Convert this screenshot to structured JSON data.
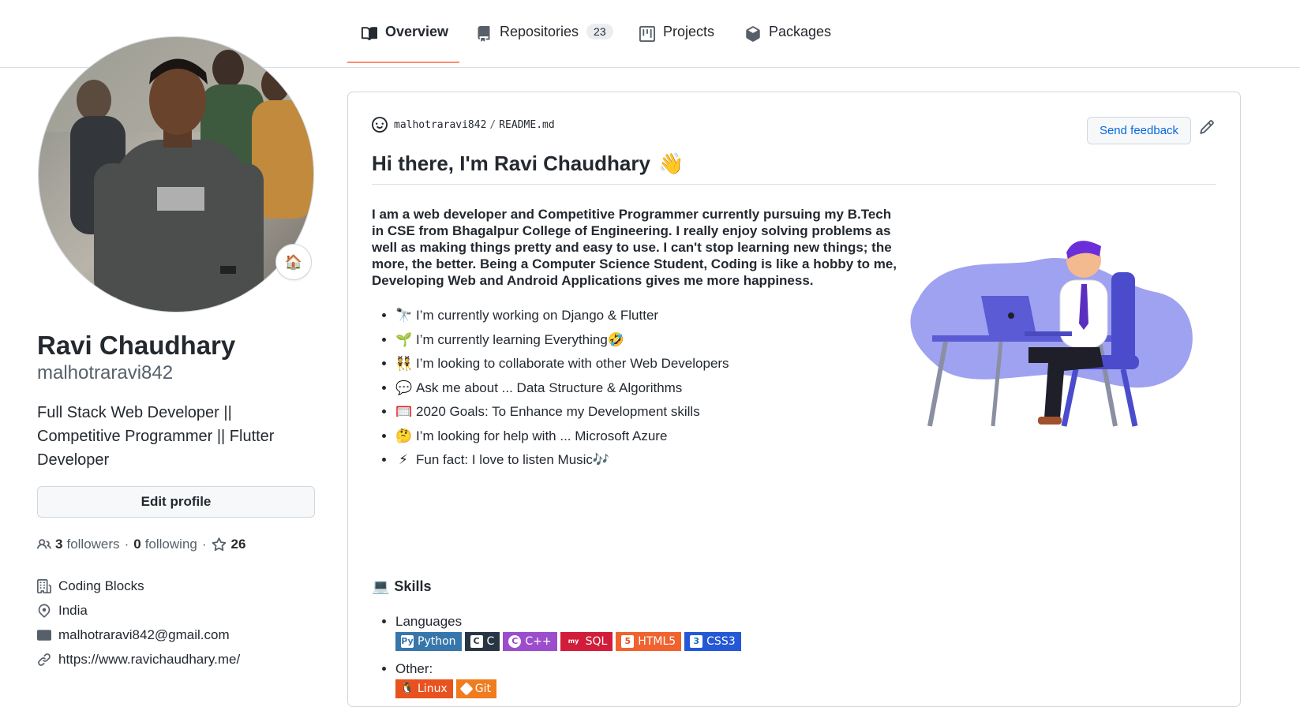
{
  "nav": {
    "tabs": [
      {
        "label": "Overview",
        "icon": "book-icon",
        "active": true
      },
      {
        "label": "Repositories",
        "icon": "repo-icon",
        "count": "23"
      },
      {
        "label": "Projects",
        "icon": "project-icon"
      },
      {
        "label": "Packages",
        "icon": "package-icon"
      }
    ]
  },
  "profile": {
    "name": "Ravi Chaudhary",
    "login": "malhotraravi842",
    "bio": "Full Stack Web Developer || Competitive Programmer || Flutter Developer",
    "status_emoji": "🏠",
    "edit_label": "Edit profile",
    "followers_count": "3",
    "followers_label": "followers",
    "following_count": "0",
    "following_label": "following",
    "stars_count": "26",
    "separator": "·",
    "company": "Coding Blocks",
    "location": "India",
    "email": "malhotraravi842@gmail.com",
    "website": "https://www.ravichaudhary.me/"
  },
  "readme": {
    "owner": "malhotraravi842",
    "separator": "/",
    "file": "README.md",
    "feedback_label": "Send feedback",
    "title": "Hi there, I'm Ravi Chaudhary",
    "title_emoji": "👋",
    "intro": "I am a web developer and Competitive Programmer currently pursuing my B.Tech in CSE from Bhagalpur College of Engineering. I really enjoy solving problems as well as making things pretty and easy to use. I can't stop learning new things; the more, the better. Being a Computer Science Student, Coding is like a hobby to me, Developing Web and Android Applications gives me more happiness.",
    "facts": [
      {
        "emoji": "🔭",
        "text": "I’m currently working on Django & Flutter"
      },
      {
        "emoji": "🌱",
        "text": "I’m currently learning Everything🤣"
      },
      {
        "emoji": "👯",
        "text": "I’m looking to collaborate with other Web Developers"
      },
      {
        "emoji": "💬",
        "text": "Ask me about ... Data Structure & Algorithms"
      },
      {
        "emoji": "🥅",
        "text": "2020 Goals: To Enhance my Development skills"
      },
      {
        "emoji": "🤔",
        "text": "I’m looking for help with ... Microsoft Azure"
      },
      {
        "emoji": "⚡",
        "text": "Fun fact: I love to listen Music🎶"
      }
    ],
    "skills_emoji": "💻",
    "skills_title": "Skills",
    "languages_label": "Languages",
    "languages": [
      {
        "label": "Python",
        "color": "#3776ab",
        "icon": "python-icon"
      },
      {
        "label": "C",
        "color": "#03599c",
        "icon": "c-icon"
      },
      {
        "label": "C++",
        "color": "#9c4dcc",
        "icon": "cpp-icon"
      },
      {
        "label": "SQL",
        "color": "#e02525",
        "icon": "mysql-icon"
      },
      {
        "label": "HTML5",
        "color": "#e34f26",
        "icon": "html5-icon"
      },
      {
        "label": "CSS3",
        "color": "#1572b6",
        "icon": "css3-icon"
      }
    ],
    "other_label": "Other:",
    "other": [
      {
        "label": "Linux",
        "color": "#fcc624",
        "icon": "linux-icon"
      },
      {
        "label": "Git",
        "color": "#f05032",
        "icon": "git-icon"
      }
    ]
  }
}
